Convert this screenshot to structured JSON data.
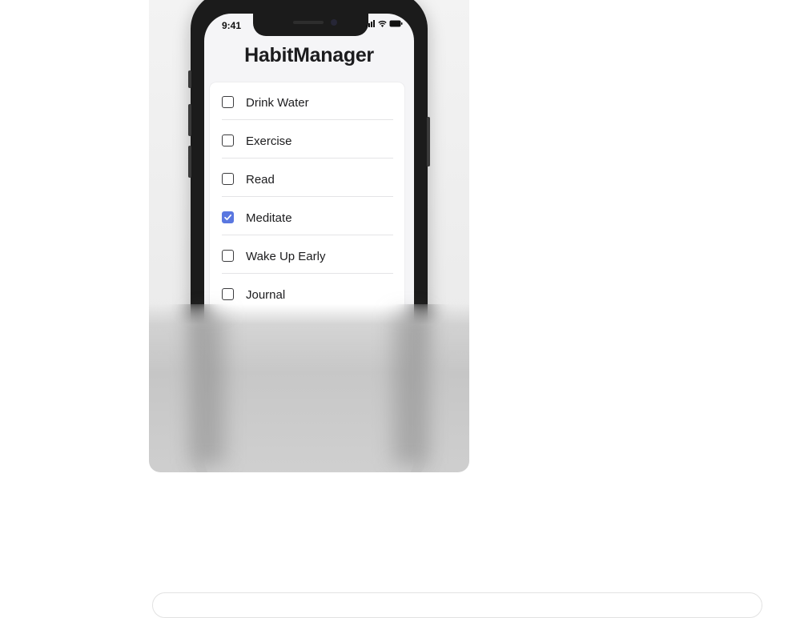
{
  "status_bar": {
    "time": "9:41",
    "icons": [
      "signal-icon",
      "wifi-icon",
      "battery-icon"
    ]
  },
  "app": {
    "title": "HabitManager"
  },
  "habits": [
    {
      "label": "Drink Water",
      "checked": false
    },
    {
      "label": "Exercise",
      "checked": false
    },
    {
      "label": "Read",
      "checked": false
    },
    {
      "label": "Meditate",
      "checked": true
    },
    {
      "label": "Wake Up Early",
      "checked": false
    },
    {
      "label": "Journal",
      "checked": false
    }
  ],
  "colors": {
    "accent": "#5a77e0",
    "text": "#1c1c1e",
    "background": "#f5f5f7"
  }
}
